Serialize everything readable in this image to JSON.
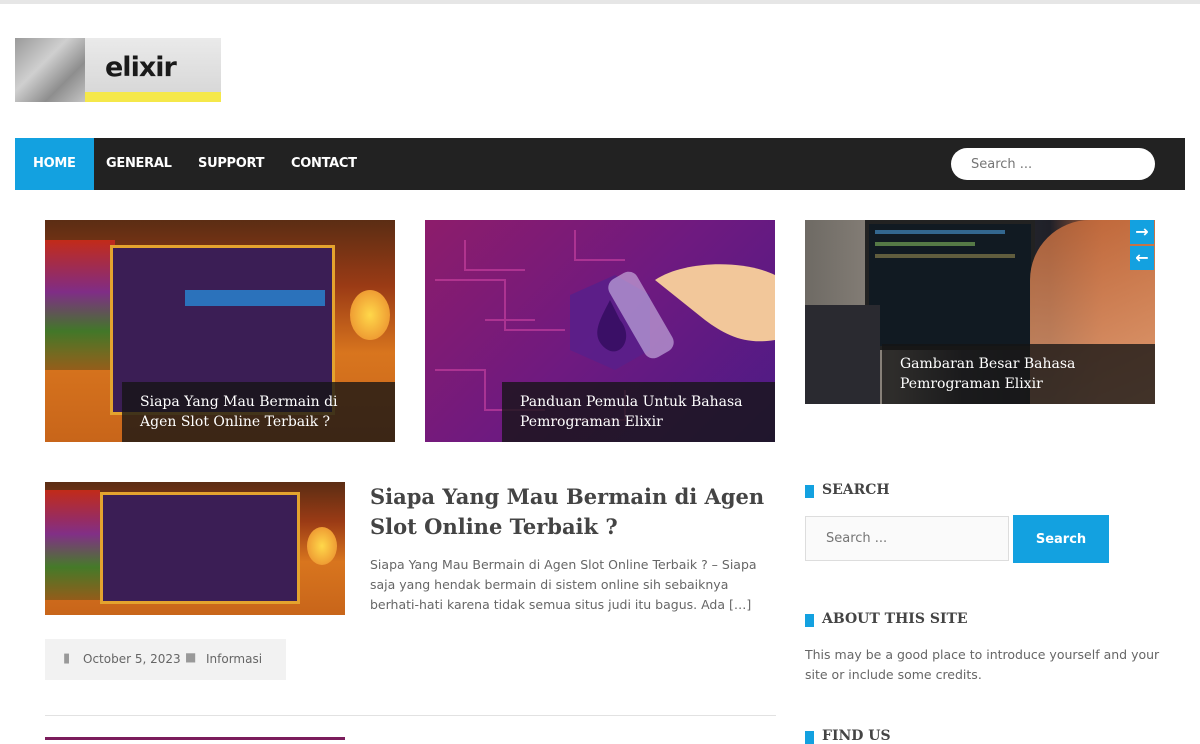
{
  "brand": {
    "logo_text": "elixir"
  },
  "nav": {
    "items": [
      {
        "label": "HOME",
        "active": true
      },
      {
        "label": "GENERAL",
        "active": false
      },
      {
        "label": "SUPPORT",
        "active": false
      },
      {
        "label": "CONTACT",
        "active": false
      }
    ],
    "search_placeholder": "Search ..."
  },
  "featured": [
    {
      "title": "Siapa Yang Mau Bermain di Agen Slot Online Terbaik ?",
      "image": "slot-game"
    },
    {
      "title": "Panduan Pemula Untuk Bahasa Pemrograman Elixir",
      "image": "elixir-flask"
    },
    {
      "title": "Gambaran Besar Bahasa Pemrograman Elixir",
      "image": "developer-monitor"
    }
  ],
  "slider_controls": {
    "next_icon": "arrow-right-icon",
    "prev_icon": "arrow-left-icon"
  },
  "post": {
    "title": "Siapa Yang Mau Bermain di Agen Slot Online Terbaik ?",
    "excerpt": "Siapa Yang Mau Bermain di Agen Slot Online Terbaik ? – Siapa saja yang hendak bermain di sistem online sih sebaiknya berhati-hati karena tidak semua situs judi itu bagus. Ada […]",
    "date": "October 5, 2023",
    "category": "Informasi"
  },
  "sidebar": {
    "search_title": "SEARCH",
    "search_placeholder": "Search ...",
    "search_button": "Search",
    "about_title": "ABOUT THIS SITE",
    "about_text": "This may be a good place to introduce yourself and your site or include some credits.",
    "find_title": "FIND US"
  },
  "colors": {
    "accent": "#13a1e0",
    "nav_bg": "#222222"
  }
}
